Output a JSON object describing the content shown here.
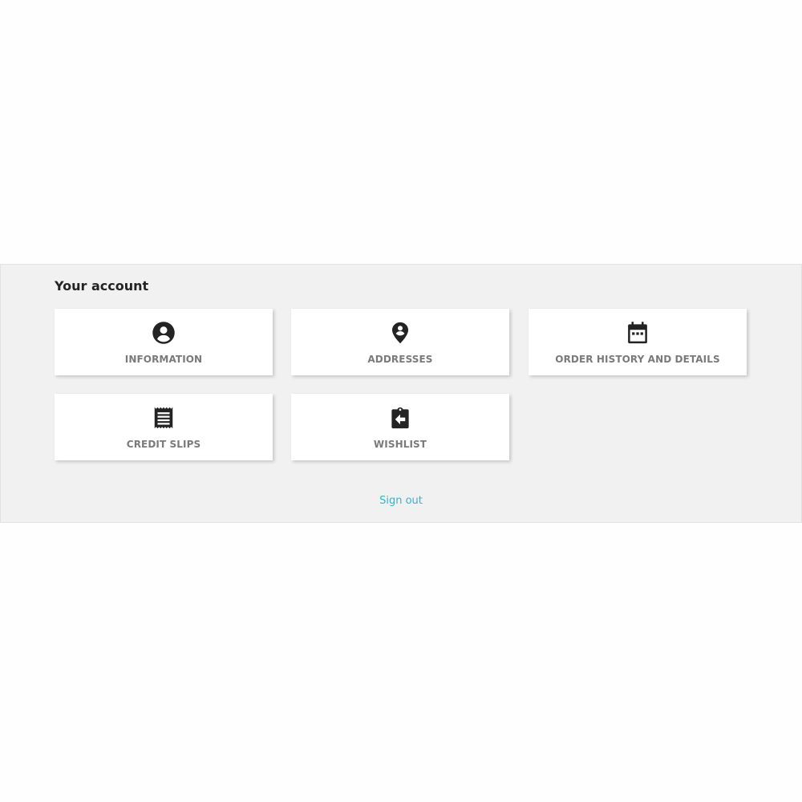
{
  "account": {
    "title": "Your account",
    "tiles": [
      {
        "label": "INFORMATION",
        "icon": "account-circle-icon"
      },
      {
        "label": "ADDRESSES",
        "icon": "location-pin-icon"
      },
      {
        "label": "ORDER HISTORY AND DETAILS",
        "icon": "calendar-icon"
      },
      {
        "label": "CREDIT SLIPS",
        "icon": "receipt-icon"
      },
      {
        "label": "WISHLIST",
        "icon": "clipboard-arrow-icon"
      }
    ],
    "sign_out": "Sign out"
  },
  "colors": {
    "section_background": "#f1f1f1",
    "tile_background": "#ffffff",
    "tile_label": "#7a7a7a",
    "title": "#232323",
    "icon": "#232323",
    "link": "#2fb5d2"
  }
}
